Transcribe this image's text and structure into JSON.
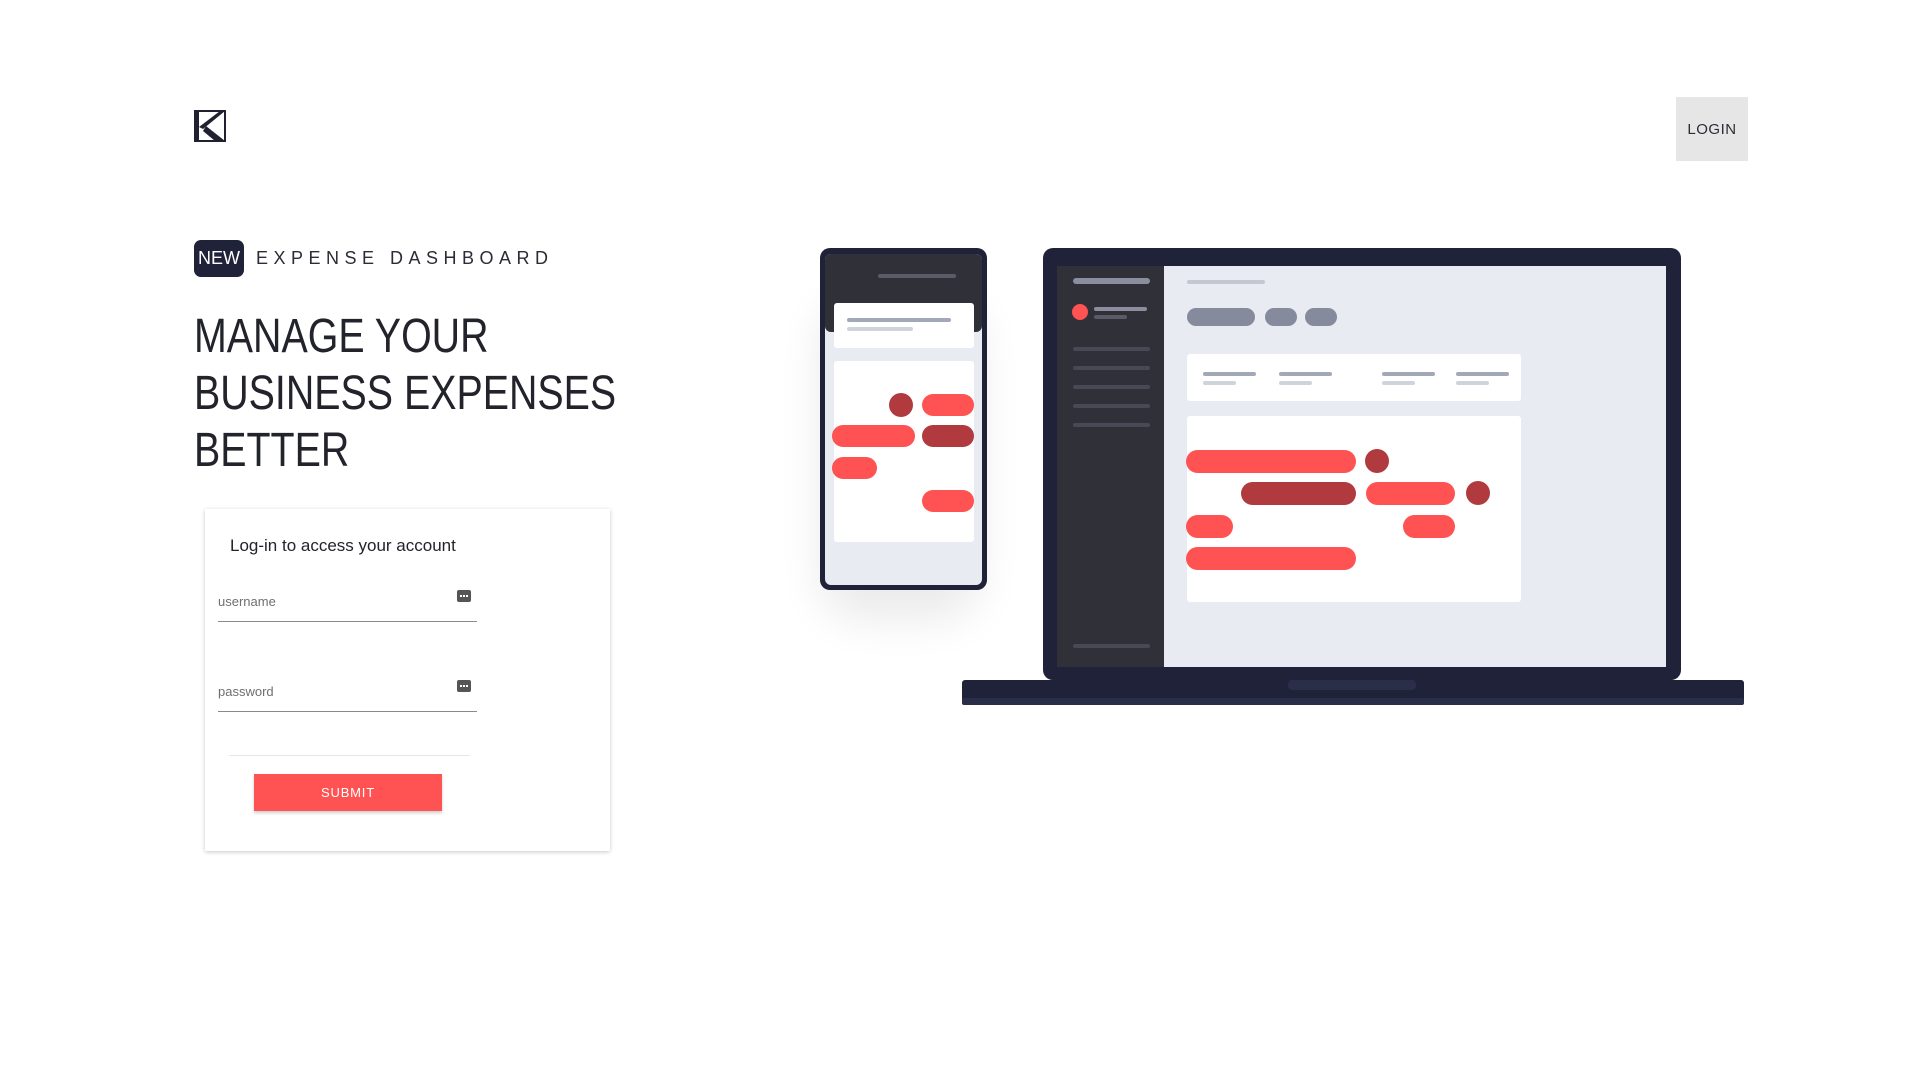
{
  "header": {
    "logo_icon": "k-logo-icon",
    "login_label": "LOGIN"
  },
  "hero": {
    "badge": "NEW",
    "eyebrow": "EXPENSE DASHBOARD",
    "title_lines": [
      "MANAGE YOUR",
      "BUSINESS EXPENSES",
      "BETTER"
    ]
  },
  "login_card": {
    "heading": "Log-in to access your account",
    "username_placeholder": "username",
    "password_placeholder": "password",
    "field_icon": "key-icon",
    "submit_label": "SUBMIT"
  },
  "colors": {
    "accent": "#ff5252",
    "accent_dark": "#b03a3e",
    "navy": "#1f2238",
    "panel": "#e8ebf1",
    "sidebar": "#2f3038"
  }
}
